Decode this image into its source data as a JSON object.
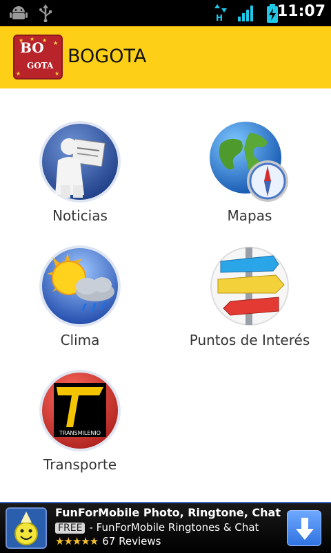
{
  "status_bar": {
    "time": "11:07",
    "network_type": "H",
    "icons": [
      "android-debug-icon",
      "usb-icon",
      "data-activity-icon",
      "signal-icon",
      "battery-charging-icon"
    ]
  },
  "title_bar": {
    "app_name": "BOGOTA",
    "logo_text_top": "BO",
    "logo_text_bottom": "GOTA"
  },
  "grid": {
    "items": [
      {
        "label": "Noticias",
        "icon": "news-icon"
      },
      {
        "label": "Mapas",
        "icon": "globe-compass-icon"
      },
      {
        "label": "Clima",
        "icon": "weather-icon"
      },
      {
        "label": "Puntos de Interés",
        "icon": "signpost-icon"
      },
      {
        "label": "Transporte",
        "icon": "transmilenio-icon",
        "icon_text": "TRANSMILENIO"
      }
    ]
  },
  "ad": {
    "title": "FunForMobile Photo, Ringtone, Chat",
    "badge": "FREE",
    "subtitle": "- FunForMobile Ringtones & Chat",
    "stars": "★★★★★",
    "rating": 4.5,
    "reviews": "67 Reviews"
  },
  "colors": {
    "title_bar": "#fdd017",
    "status_bar": "#000000",
    "ad_border": "#3b68c7"
  }
}
